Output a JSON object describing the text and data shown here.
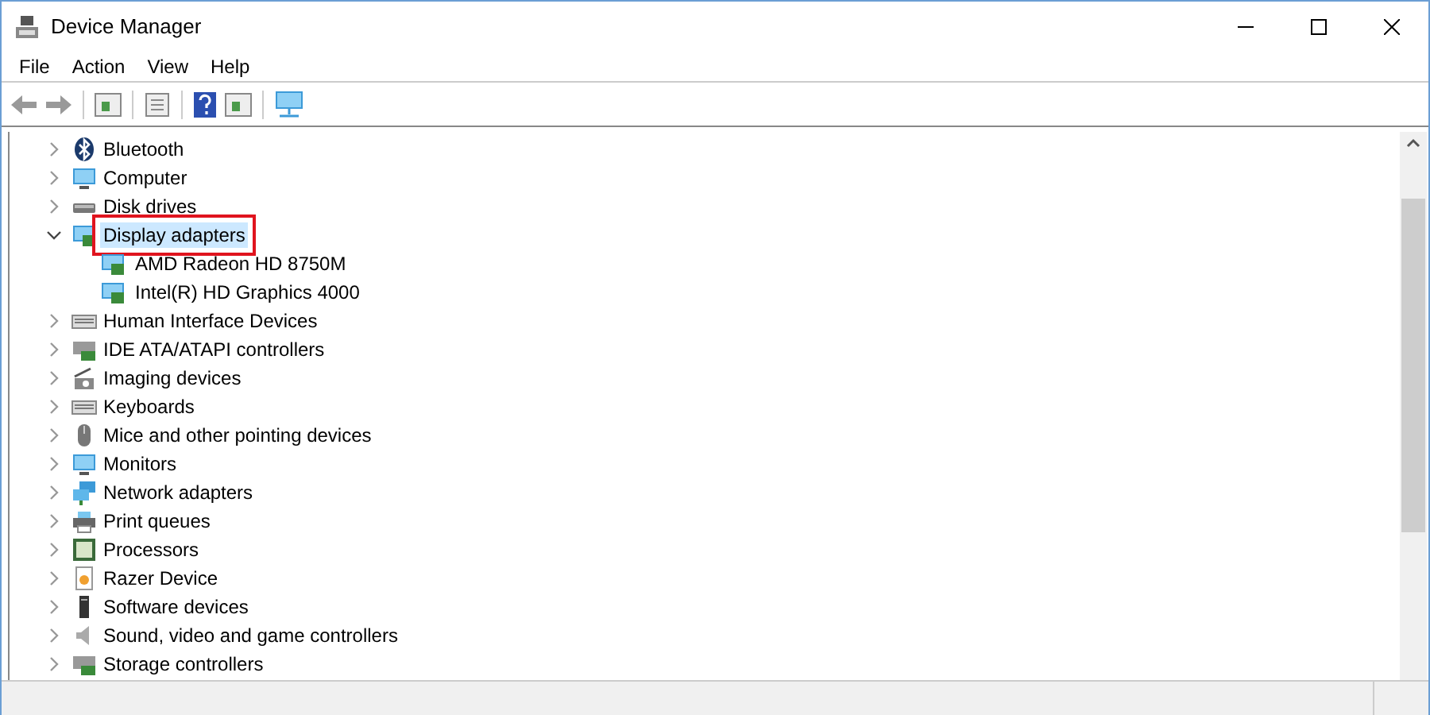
{
  "window": {
    "title": "Device Manager"
  },
  "menu": [
    "File",
    "Action",
    "View",
    "Help"
  ],
  "tree": [
    {
      "label": "Bluetooth",
      "expanded": false,
      "selected": false
    },
    {
      "label": "Computer",
      "expanded": false,
      "selected": false
    },
    {
      "label": "Disk drives",
      "expanded": false,
      "selected": false
    },
    {
      "label": "Display adapters",
      "expanded": true,
      "selected": true,
      "children": [
        {
          "label": "AMD Radeon HD 8750M"
        },
        {
          "label": "Intel(R) HD Graphics 4000"
        }
      ]
    },
    {
      "label": "Human Interface Devices",
      "expanded": false,
      "selected": false
    },
    {
      "label": "IDE ATA/ATAPI controllers",
      "expanded": false,
      "selected": false
    },
    {
      "label": "Imaging devices",
      "expanded": false,
      "selected": false
    },
    {
      "label": "Keyboards",
      "expanded": false,
      "selected": false
    },
    {
      "label": "Mice and other pointing devices",
      "expanded": false,
      "selected": false
    },
    {
      "label": "Monitors",
      "expanded": false,
      "selected": false
    },
    {
      "label": "Network adapters",
      "expanded": false,
      "selected": false
    },
    {
      "label": "Print queues",
      "expanded": false,
      "selected": false
    },
    {
      "label": "Processors",
      "expanded": false,
      "selected": false
    },
    {
      "label": "Razer Device",
      "expanded": false,
      "selected": false
    },
    {
      "label": "Software devices",
      "expanded": false,
      "selected": false
    },
    {
      "label": "Sound, video and game controllers",
      "expanded": false,
      "selected": false
    },
    {
      "label": "Storage controllers",
      "expanded": false,
      "selected": false
    }
  ]
}
